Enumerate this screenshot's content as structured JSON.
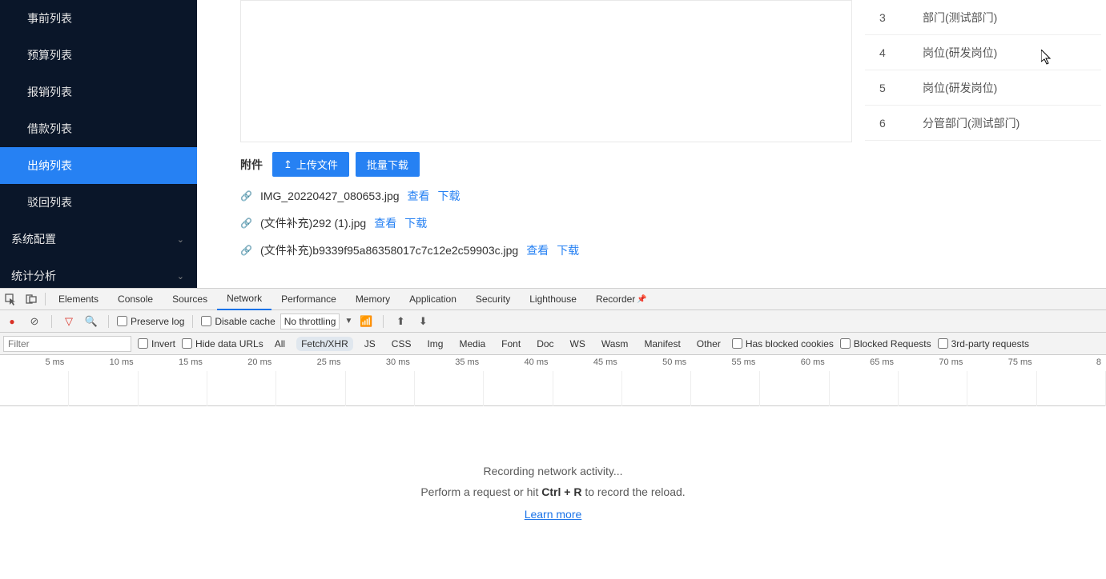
{
  "sidebar": {
    "items": [
      {
        "label": "事前列表"
      },
      {
        "label": "预算列表"
      },
      {
        "label": "报销列表"
      },
      {
        "label": "借款列表"
      },
      {
        "label": "出纳列表"
      },
      {
        "label": "驳回列表"
      }
    ],
    "expandable": [
      {
        "label": "系统配置"
      },
      {
        "label": "统计分析"
      }
    ]
  },
  "rightTable": {
    "rows": [
      {
        "num": "3",
        "value": "部门(测试部门)"
      },
      {
        "num": "4",
        "value": "岗位(研发岗位)"
      },
      {
        "num": "5",
        "value": "岗位(研发岗位)"
      },
      {
        "num": "6",
        "value": "分管部门(测试部门)"
      }
    ]
  },
  "attachments": {
    "title": "附件",
    "uploadLabel": "上传文件",
    "batchLabel": "批量下载",
    "viewLabel": "查看",
    "downloadLabel": "下载",
    "files": [
      {
        "name": "IMG_20220427_080653.jpg"
      },
      {
        "name": "(文件补充)292 (1).jpg"
      },
      {
        "name": "(文件补充)b9339f95a86358017c7c12e2c59903c.jpg"
      }
    ]
  },
  "devtools": {
    "tabs": [
      "Elements",
      "Console",
      "Sources",
      "Network",
      "Performance",
      "Memory",
      "Application",
      "Security",
      "Lighthouse",
      "Recorder"
    ],
    "toolbar": {
      "preserveLog": "Preserve log",
      "disableCache": "Disable cache",
      "throttling": "No throttling"
    },
    "filters": {
      "placeholder": "Filter",
      "invert": "Invert",
      "hideDataUrls": "Hide data URLs",
      "types": [
        "All",
        "Fetch/XHR",
        "JS",
        "CSS",
        "Img",
        "Media",
        "Font",
        "Doc",
        "WS",
        "Wasm",
        "Manifest",
        "Other"
      ],
      "hasBlocked": "Has blocked cookies",
      "blockedReq": "Blocked Requests",
      "thirdParty": "3rd-party requests"
    },
    "timeline": [
      "5 ms",
      "10 ms",
      "15 ms",
      "20 ms",
      "25 ms",
      "30 ms",
      "35 ms",
      "40 ms",
      "45 ms",
      "50 ms",
      "55 ms",
      "60 ms",
      "65 ms",
      "70 ms",
      "75 ms",
      "8"
    ],
    "empty": {
      "line1": "Recording network activity...",
      "line2a": "Perform a request or hit ",
      "line2b": "Ctrl + R",
      "line2c": " to record the reload.",
      "learnMore": "Learn more"
    }
  }
}
